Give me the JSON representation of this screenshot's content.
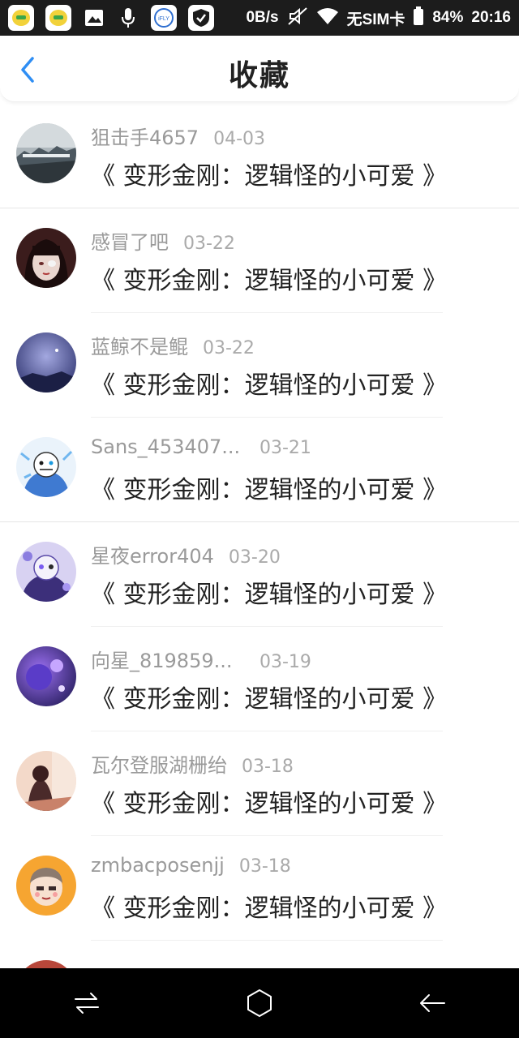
{
  "status_bar": {
    "speed": "0B/s",
    "sim": "无SIM卡",
    "battery": "84%",
    "time": "20:16",
    "icons": [
      "app-face-icon",
      "app-face-icon",
      "gallery-icon",
      "microphone-icon",
      "ifly-icon",
      "shield-check-icon",
      "mute-icon",
      "wifi-icon",
      "battery-icon"
    ]
  },
  "header": {
    "title": "收藏",
    "back_icon": "chevron-left-icon"
  },
  "colors": {
    "accent": "#2f8ef4",
    "text_primary": "#222222",
    "text_secondary": "#9a9a9a"
  },
  "items": [
    {
      "user": "狙击手4657",
      "date": "04-03",
      "title": "《 变形金刚：逻辑怪的小可爱 》"
    },
    {
      "user": "感冒了吧",
      "date": "03-22",
      "title": "《 变形金刚：逻辑怪的小可爱 》"
    },
    {
      "user": "蓝鲸不是鲲",
      "date": "03-22",
      "title": "《 变形金刚：逻辑怪的小可爱 》"
    },
    {
      "user": "Sans_453407...",
      "date": "03-21",
      "title": "《 变形金刚：逻辑怪的小可爱 》"
    },
    {
      "user": "星夜error404",
      "date": "03-20",
      "title": "《 变形金刚：逻辑怪的小可爱 》"
    },
    {
      "user": "向星_819859...",
      "date": "03-19",
      "title": "《 变形金刚：逻辑怪的小可爱 》"
    },
    {
      "user": "瓦尔登服湖栅绐",
      "date": "03-18",
      "title": "《 变形金刚：逻辑怪的小可爱 》"
    },
    {
      "user": "zmbacposenjj",
      "date": "03-18",
      "title": "《 变形金刚：逻辑怪的小可爱 》"
    }
  ],
  "nav_bar": {
    "icons": [
      "switch-apps-icon",
      "home-icon",
      "back-arrow-icon"
    ]
  }
}
